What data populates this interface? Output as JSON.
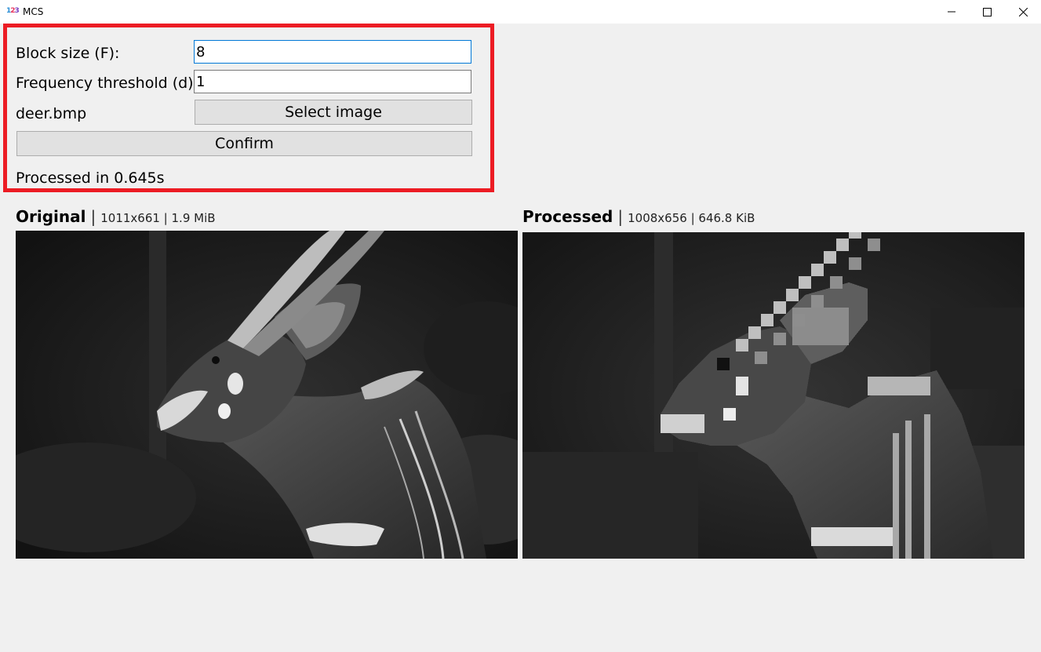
{
  "window": {
    "title": "MCS",
    "icon": "app-icon-123"
  },
  "controls": {
    "block_size_label": "Block size (F):",
    "block_size_value": "8",
    "freq_threshold_label": "Frequency threshold (d):",
    "freq_threshold_value": "1",
    "file_name": "deer.bmp",
    "select_image_label": "Select image",
    "confirm_label": "Confirm",
    "status_text": "Processed in 0.645s"
  },
  "original": {
    "title": "Original",
    "meta": "1011x661 | 1.9 MiB"
  },
  "processed": {
    "title": "Processed",
    "meta": "1008x656 | 646.8 KiB"
  },
  "colors": {
    "highlight_border": "#ec1c24",
    "focus_border": "#0078d7",
    "button_bg": "#e1e1e1"
  }
}
